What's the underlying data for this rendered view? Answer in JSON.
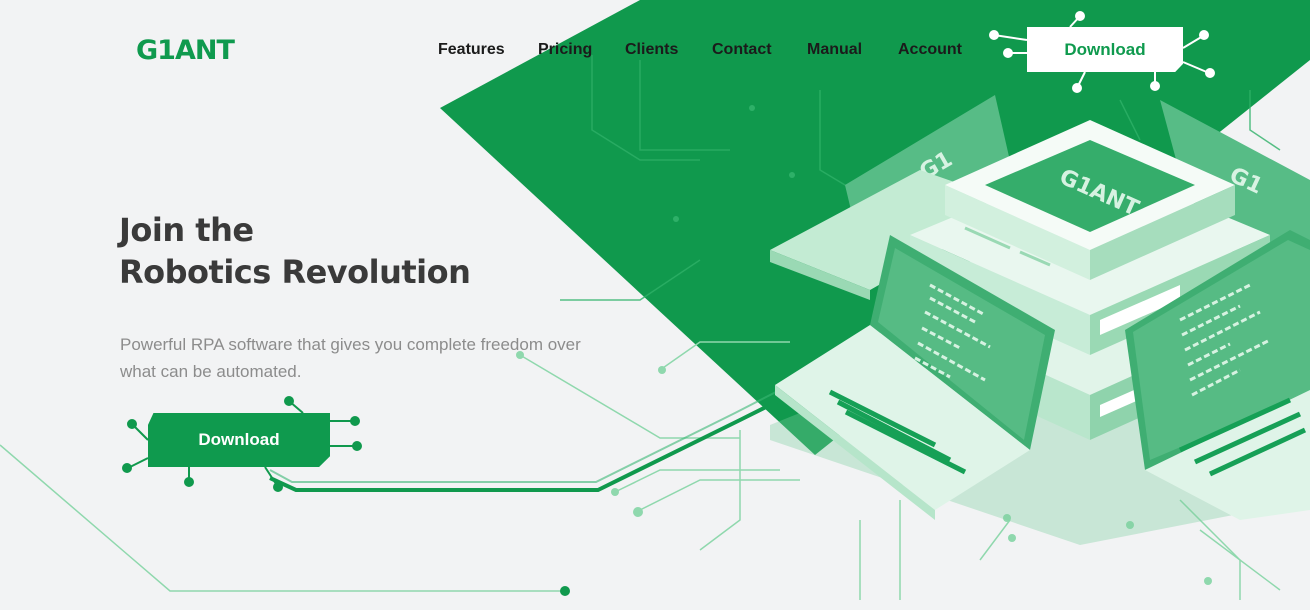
{
  "brand": {
    "logo_text": "G1ANT",
    "primary_color": "#0f9a4e"
  },
  "nav": {
    "items": [
      {
        "label": "Features"
      },
      {
        "label": "Pricing"
      },
      {
        "label": "Clients"
      },
      {
        "label": "Contact"
      },
      {
        "label": "Manual"
      },
      {
        "label": "Account"
      }
    ],
    "download_label": "Download"
  },
  "hero": {
    "headline_line1": "Join the",
    "headline_line2": "Robotics Revolution",
    "subtext": "Powerful RPA software that gives you complete freedom over what can be automated.",
    "cta_label": "Download",
    "illustration": "isometric-server-with-laptops"
  },
  "colors": {
    "background": "#f2f3f4",
    "green": "#0f9a4e",
    "light_green": "#7ccf9f",
    "text_dark": "#3a3a3a",
    "text_muted": "#8c8c8c"
  }
}
